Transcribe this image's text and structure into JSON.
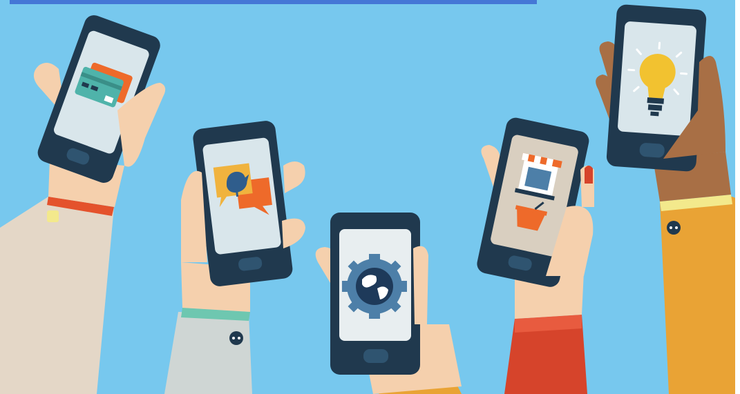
{
  "scene": {
    "subject": "hands-holding-smartphones",
    "palette": {
      "sky": "#77c8ee",
      "top_band": "#4577d6",
      "phone_body": "#20394e",
      "phone_bezel": "#2f5470",
      "screen_light": "#d9e6eb",
      "screen_beige": "#d9cfc0",
      "skin_light": "#f5d0ad",
      "skin_dark": "#a86f45",
      "sleeve_beige": "#e4d7c7",
      "sleeve_grey": "#cfd6d4",
      "sleeve_red": "#d6442b",
      "sleeve_yellow": "#e9a335",
      "accent_orange": "#ee6a2a",
      "accent_teal": "#4fb3aa"
    },
    "phones": [
      {
        "icon": "credit-card-icon"
      },
      {
        "icon": "chat-bird-icon"
      },
      {
        "icon": "globe-gear-icon"
      },
      {
        "icon": "shop-basket-icon"
      },
      {
        "icon": "light-bulb-icon"
      }
    ]
  }
}
